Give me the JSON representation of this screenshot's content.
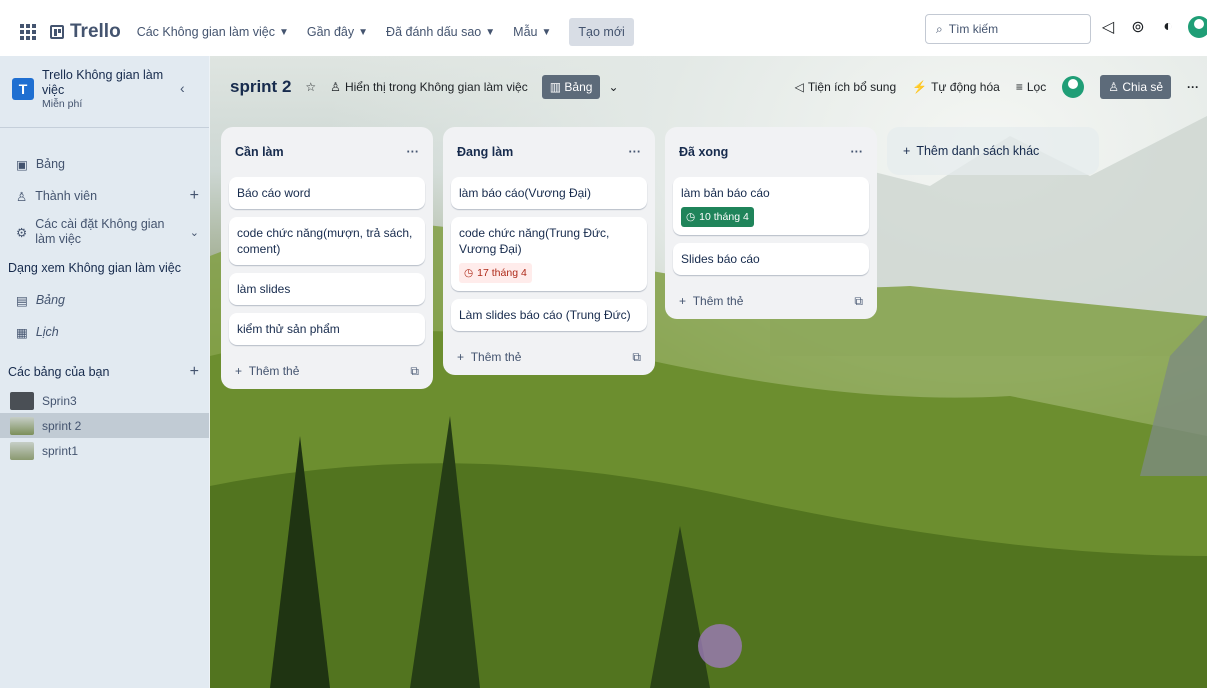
{
  "topbar": {
    "logo": "Trello",
    "nav": [
      {
        "label": "Các Không gian làm việc"
      },
      {
        "label": "Gần đây"
      },
      {
        "label": "Đã đánh dấu sao"
      },
      {
        "label": "Mẫu"
      }
    ],
    "create_label": "Tạo mới",
    "search_placeholder": "Tìm kiếm"
  },
  "sidebar": {
    "workspace_initial": "T",
    "workspace_name": "Trello Không gian làm việc",
    "workspace_plan": "Miễn phí",
    "items": [
      {
        "label": "Bảng"
      },
      {
        "label": "Thành viên"
      },
      {
        "label": "Các cài đặt Không gian làm việc"
      }
    ],
    "views_heading": "Dạng xem Không gian làm việc",
    "views": [
      {
        "label": "Bảng"
      },
      {
        "label": "Lịch"
      }
    ],
    "boards_heading": "Các bảng của bạn",
    "boards": [
      {
        "label": "Sprin3",
        "color": "#4a4f55"
      },
      {
        "label": "sprint 2",
        "color": "#7c8f5a"
      },
      {
        "label": "sprint1",
        "color": "#8a9970"
      }
    ]
  },
  "board": {
    "title": "sprint 2",
    "visibility": "Hiển thị trong Không gian làm việc",
    "view_label": "Bảng",
    "powerups": "Tiện ích bổ sung",
    "automation": "Tự động hóa",
    "filter": "Lọc",
    "share": "Chia sẻ",
    "more": "···"
  },
  "lists": [
    {
      "title": "Cần làm",
      "menu": "···",
      "cards": [
        {
          "text": "Báo cáo word"
        },
        {
          "text": "code chức năng(mượn, trả sách, coment)"
        },
        {
          "text": "làm slides"
        },
        {
          "text": "kiểm thử sản phẩm"
        }
      ],
      "add_card": "Thêm thẻ"
    },
    {
      "title": "Đang làm",
      "menu": "···",
      "cards": [
        {
          "text": "làm báo cáo(Vương Đại)"
        },
        {
          "text": "code chức năng(Trung Đức, Vương Đại)",
          "badge": "17 tháng 4",
          "badge_type": "red"
        },
        {
          "text": "Làm slides báo cáo (Trung Đức)"
        }
      ],
      "add_card": "Thêm thẻ"
    },
    {
      "title": "Đã xong",
      "menu": "···",
      "cards": [
        {
          "text": "làm bản báo cáo",
          "badge": "10 tháng 4",
          "badge_type": "green"
        },
        {
          "text": "Slides báo cáo"
        }
      ],
      "add_card": "Thêm thẻ"
    }
  ],
  "add_list_label": "Thêm danh sách khác",
  "colors": {
    "accent": "#0c66e4",
    "due_complete": "#1f845a",
    "due_overdue": "#ae2a19"
  }
}
